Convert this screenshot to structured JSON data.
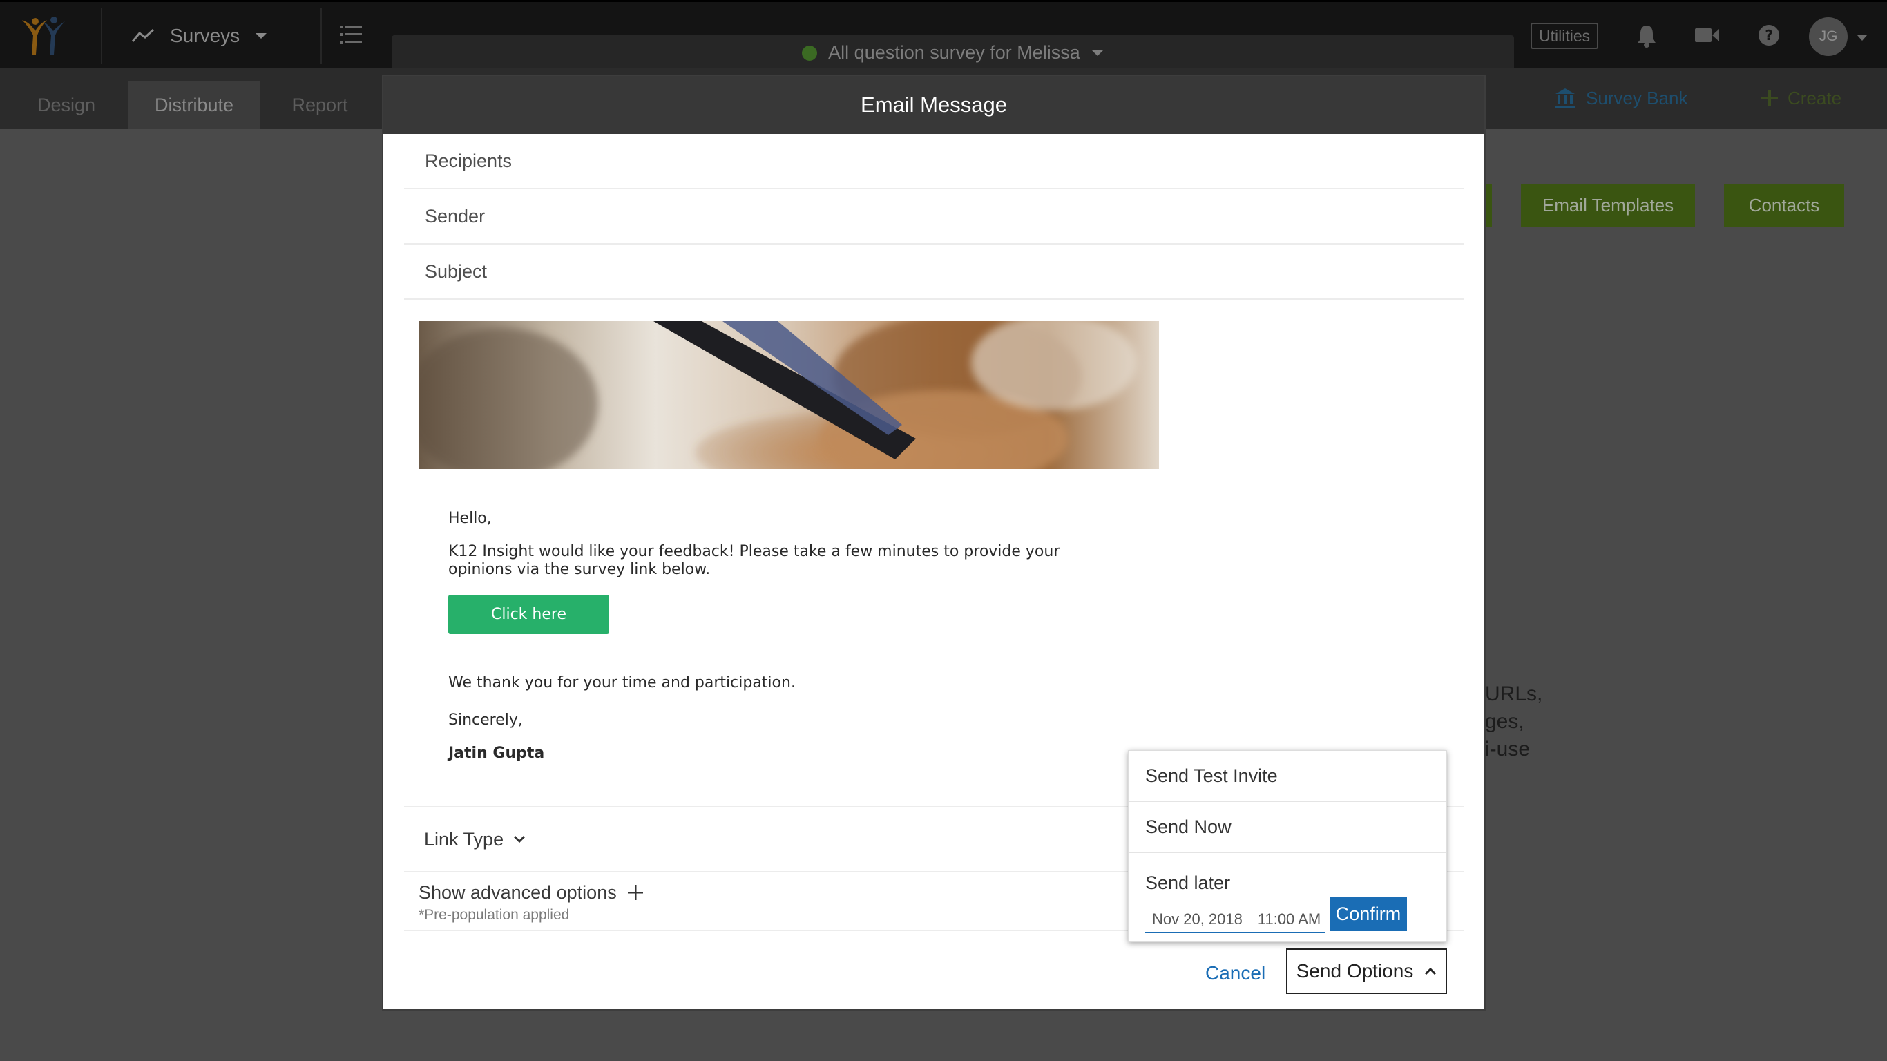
{
  "topbar": {
    "app_menu_label": "Surveys",
    "survey_name": "All question survey for Melissa",
    "utilities_label": "Utilities",
    "avatar_initials": "JG"
  },
  "subnav": {
    "tabs": [
      {
        "label": "Design",
        "active": false
      },
      {
        "label": "Distribute",
        "active": true
      },
      {
        "label": "Report",
        "active": false
      }
    ],
    "survey_bank_label": "Survey Bank",
    "create_label": "Create"
  },
  "background": {
    "email_templates_label": "Email Templates",
    "contacts_label": "Contacts",
    "partial_text": [
      "URLs,",
      "ges,",
      "i-use"
    ]
  },
  "modal": {
    "title": "Email Message",
    "fields": {
      "recipients": "Recipients",
      "sender": "Sender",
      "subject": "Subject"
    },
    "email": {
      "greeting": "Hello,",
      "body_line1": "K12 Insight would like your feedback! Please take a few minutes to provide your",
      "body_line2": "opinions via the survey link below.",
      "button_label": "Click here",
      "thanks": "We thank you for your time and participation.",
      "closing": "Sincerely,",
      "signature": "Jatin Gupta"
    },
    "link_type_label": "Link Type",
    "advanced_options_label": "Show advanced options",
    "prepopulation_note": "*Pre-population applied",
    "cancel_label": "Cancel",
    "send_options_label": "Send Options"
  },
  "send_dropdown": {
    "send_test_invite": "Send Test Invite",
    "send_now": "Send Now",
    "send_later": "Send later",
    "date_value": "Nov 20, 2018",
    "time_value": "11:00 AM",
    "confirm_label": "Confirm"
  },
  "colors": {
    "primary_blue": "#1a6db5",
    "email_button_green": "#27b06a",
    "brand_green": "#3a5511",
    "modal_header": "#383838"
  }
}
